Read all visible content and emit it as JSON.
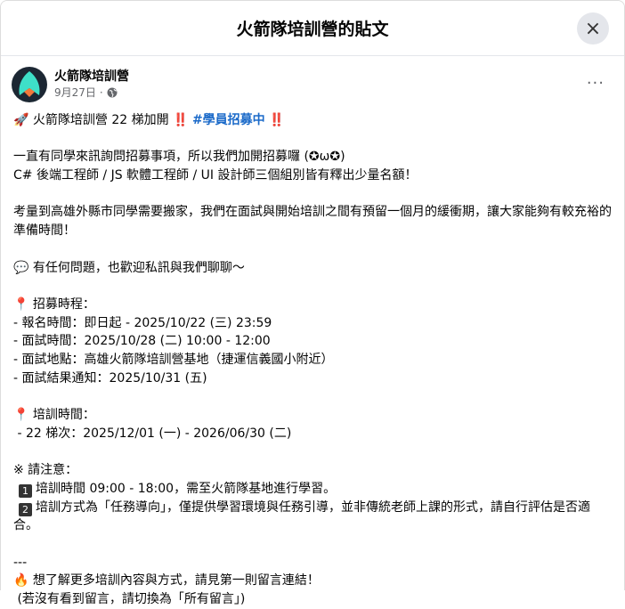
{
  "dialog": {
    "title": "火箭隊培訓營的貼文",
    "close_icon": "×"
  },
  "post": {
    "author": "火箭隊培訓營",
    "date": "9月27日",
    "more": "···",
    "headline": {
      "rocket": "🚀",
      "text": " 火箭隊培訓營 22 梯加開 ",
      "bang": "‼️",
      "hashtag": "#學員招募中"
    },
    "lines": [
      "一直有同學來訊詢問招募事項，所以我們加開招募囉 (✪ω✪)",
      "C# 後端工程師 / JS 軟體工程師 / UI 設計師三個組別皆有釋出少量名額！",
      "",
      "考量到高雄外縣市同學需要搬家，我們在面試與開始培訓之間有預留一個月的緩衝期，讓大家能夠有較充裕的準備時間！",
      "",
      "💬 有任何問題，也歡迎私訊與我們聊聊～",
      "",
      "📍 招募時程：",
      "- 報名時間：即日起 - 2025/10/22 (三) 23:59",
      "- 面試時間：2025/10/28 (二) 10:00 - 12:00",
      "- 面試地點：高雄火箭隊培訓營基地（捷運信義國小附近）",
      "- 面試結果通知：2025/10/31 (五)",
      "",
      "📍 培訓時間：",
      " - 22 梯次：2025/12/01 (一) - 2026/06/30 (二)",
      "",
      "※ 請注意："
    ],
    "notes": [
      {
        "num": "1",
        "text": "培訓時間 09:00 - 18:00，需至火箭隊基地進行學習。"
      },
      {
        "num": "2",
        "text": "培訓方式為「任務導向」，僅提供學習環境與任務引導，並非傳統老師上課的形式，請自行評估是否適合。"
      }
    ],
    "footer": [
      "",
      "---",
      "🔥 想了解更多培訓內容與方式，請見第一則留言連結！",
      " (若沒有看到留言，請切換為「所有留言」)"
    ]
  }
}
